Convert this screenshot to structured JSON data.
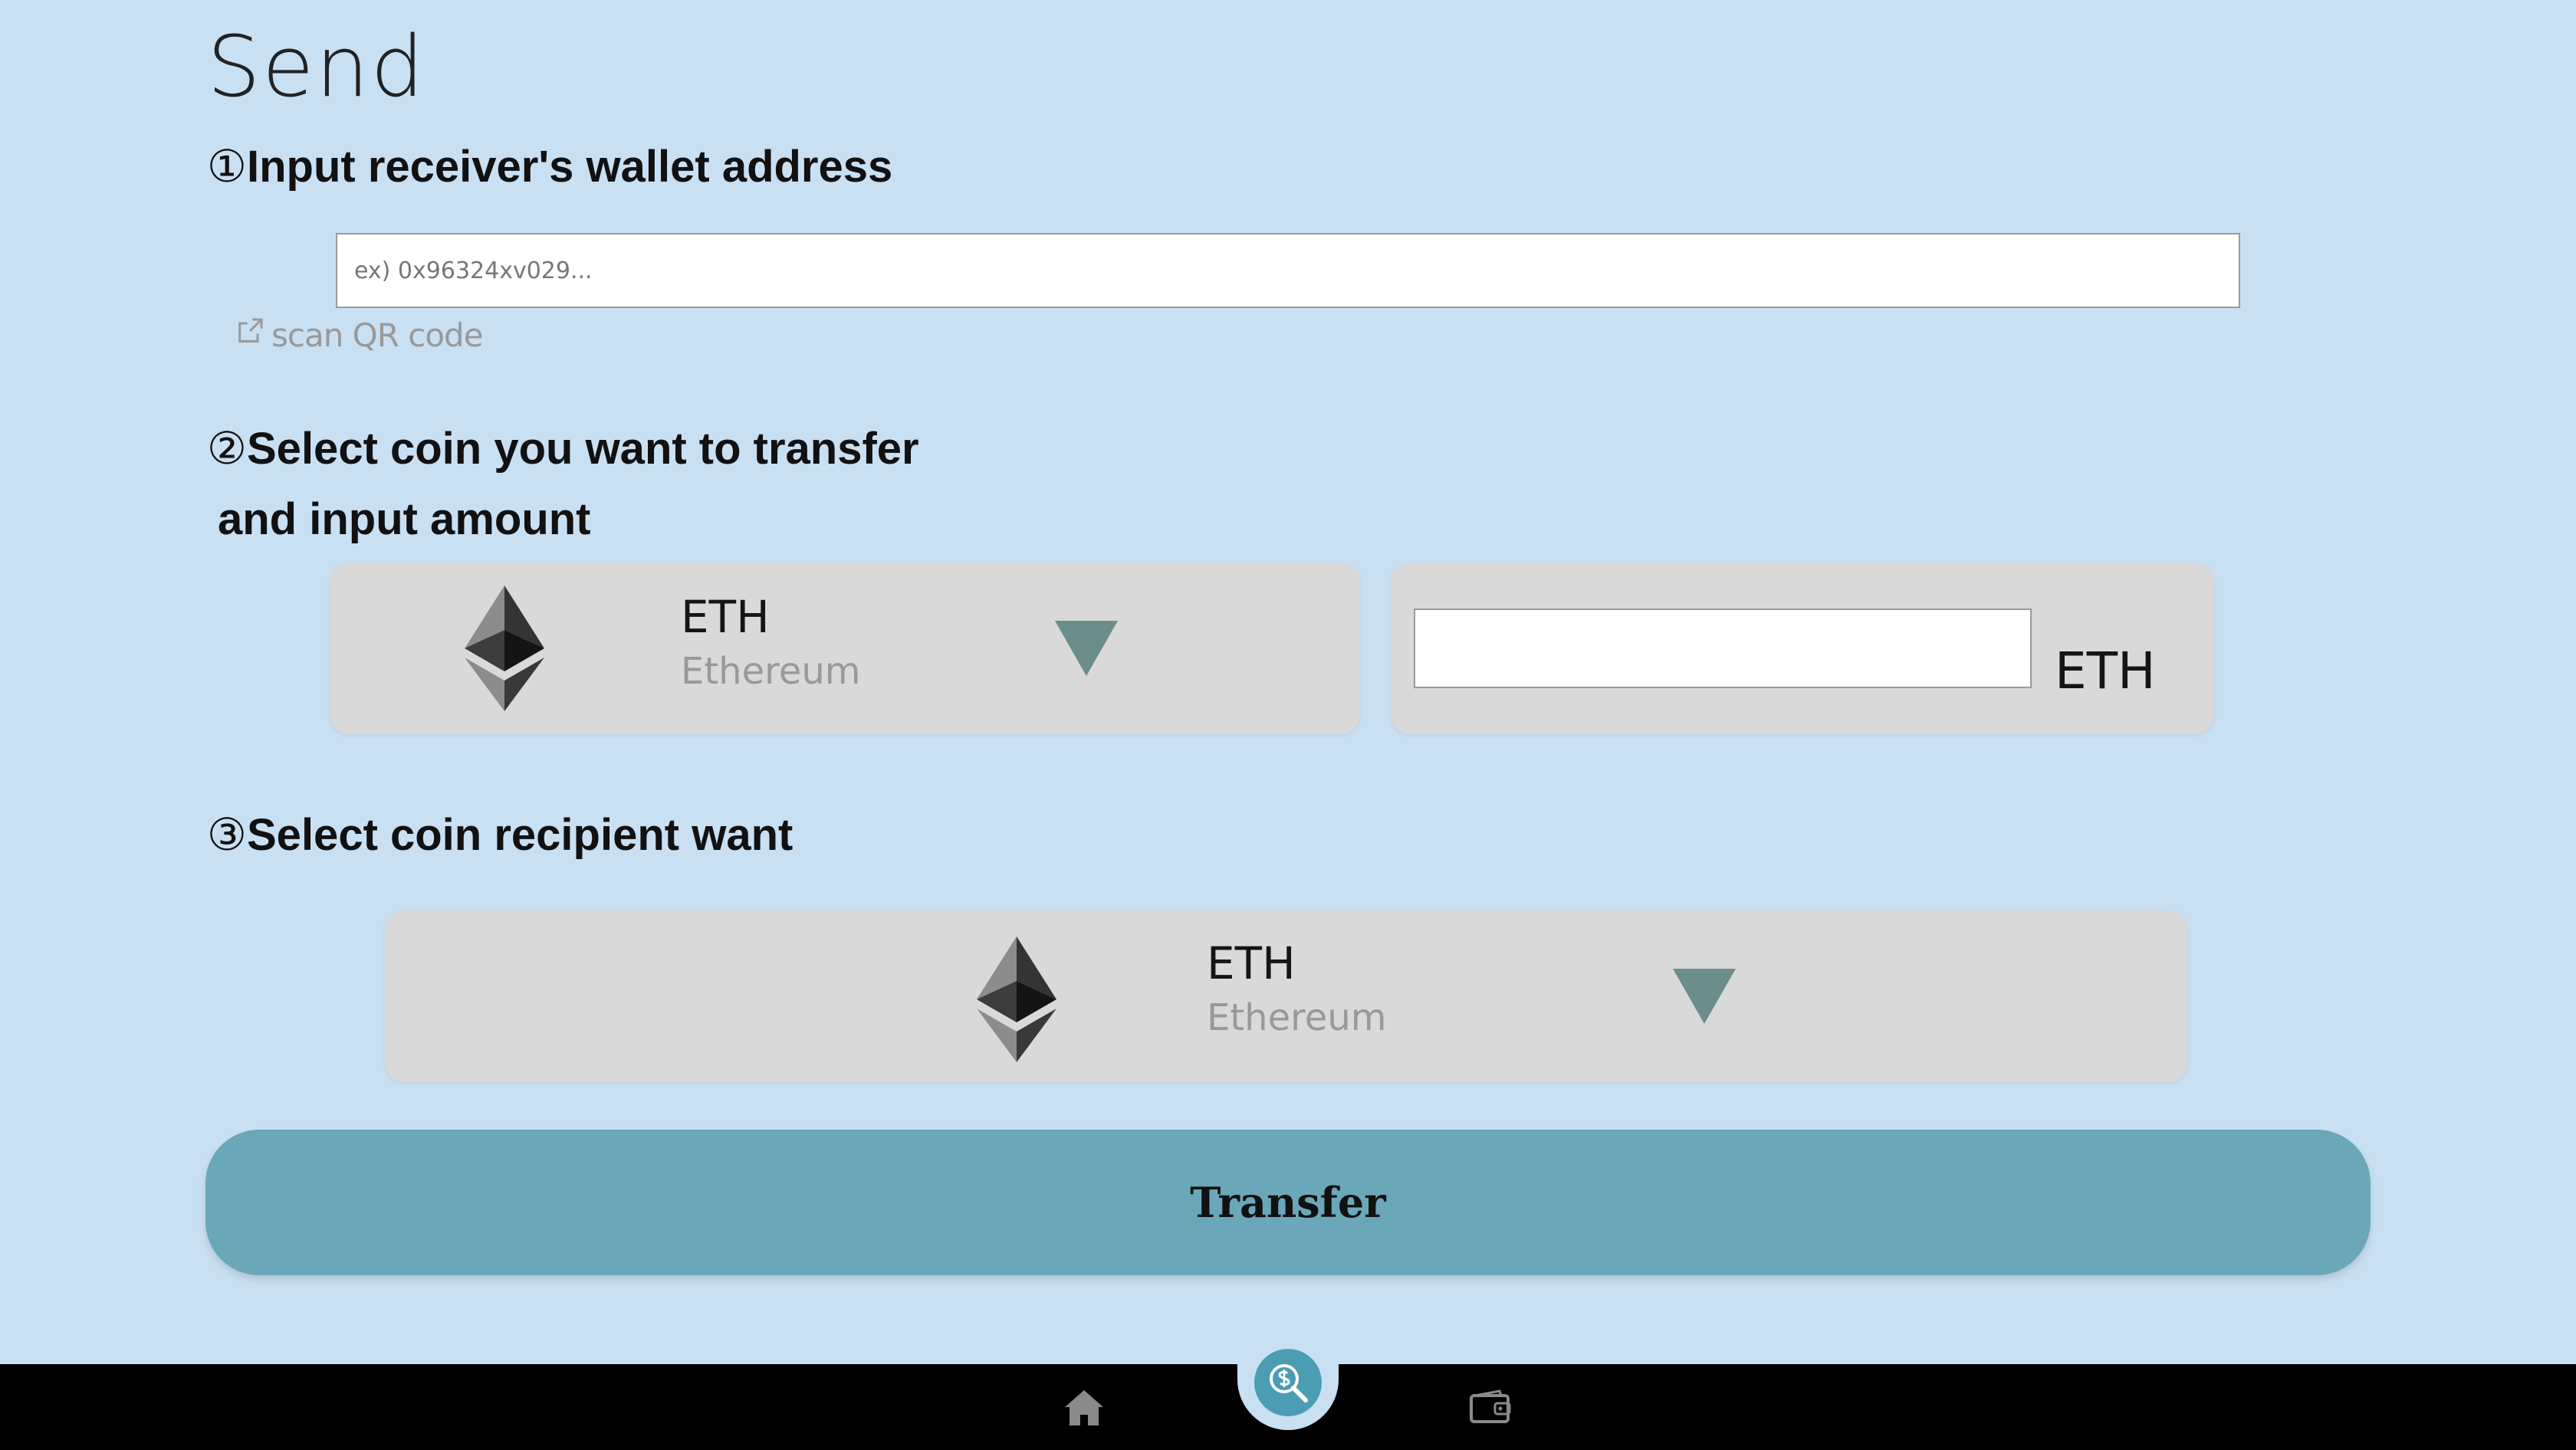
{
  "page": {
    "title": "Send"
  },
  "step1": {
    "num": "①",
    "label": "Input receiver's wallet address",
    "placeholder": "ex) 0x96324xv029...",
    "value": "",
    "scan_label": "scan QR code"
  },
  "step2": {
    "num": "②",
    "label_line1": "Select coin you want to transfer",
    "label_line2": "and input amount",
    "coin": {
      "symbol": "ETH",
      "name": "Ethereum"
    },
    "amount": {
      "value": "",
      "unit": "ETH"
    }
  },
  "step3": {
    "num": "③",
    "label": "Select coin recipient want",
    "coin": {
      "symbol": "ETH",
      "name": "Ethereum"
    }
  },
  "transfer_button": {
    "label": "Transfer"
  },
  "nav": {
    "items": [
      {
        "icon": "home-icon"
      },
      {
        "icon": "search-coin-icon",
        "active": true
      },
      {
        "icon": "wallet-icon"
      }
    ]
  },
  "colors": {
    "background": "#c9e0f2",
    "card": "#d9d9d9",
    "button": "#6aa7b9",
    "dropdown_arrow": "#6b8e8d",
    "nav_bar": "#000000",
    "nav_active": "#4b9db3"
  }
}
